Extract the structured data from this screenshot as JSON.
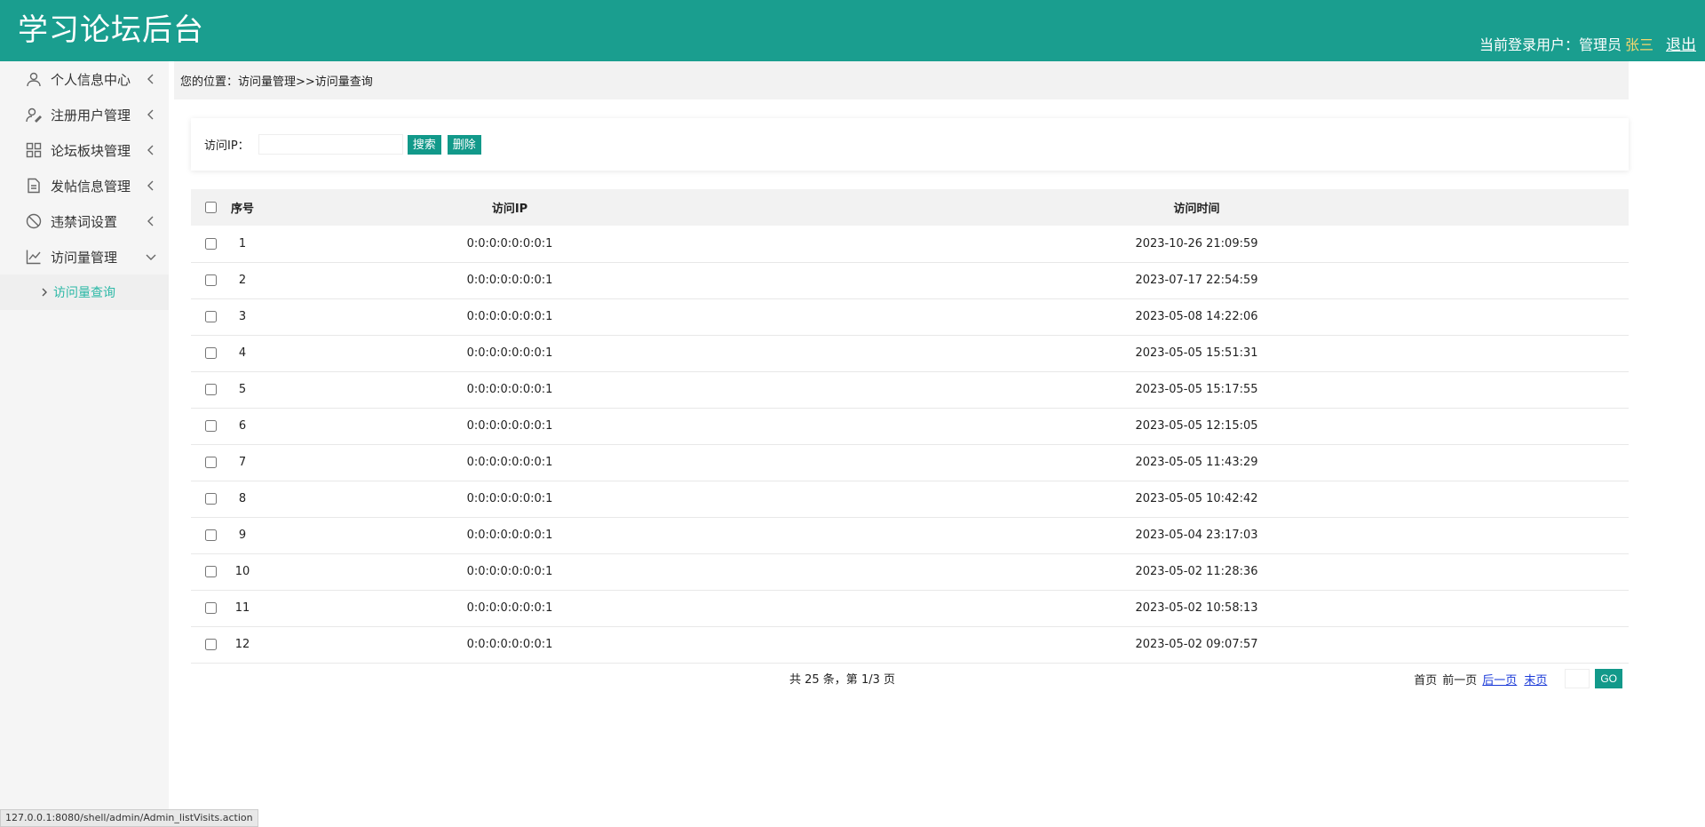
{
  "header": {
    "title": "学习论坛后台",
    "user_prefix": "当前登录用户：管理员",
    "user_name": "张三",
    "logout": "退出"
  },
  "sidebar": {
    "items": [
      {
        "label": "个人信息中心",
        "icon": "user-icon",
        "expanded": false
      },
      {
        "label": "注册用户管理",
        "icon": "user-edit-icon",
        "expanded": false
      },
      {
        "label": "论坛板块管理",
        "icon": "grid-icon",
        "expanded": false
      },
      {
        "label": "发帖信息管理",
        "icon": "document-icon",
        "expanded": false
      },
      {
        "label": "违禁词设置",
        "icon": "ban-icon",
        "expanded": false
      },
      {
        "label": "访问量管理",
        "icon": "chart-line-icon",
        "expanded": true
      }
    ],
    "sub_items": [
      {
        "label": "访问量查询"
      }
    ]
  },
  "breadcrumb": "您的位置：访问量管理>>访问量查询",
  "search": {
    "label": "访问IP：",
    "value": "",
    "search_button": "搜索",
    "delete_button": "删除"
  },
  "table": {
    "headers": [
      "序号",
      "访问IP",
      "访问时间"
    ],
    "rows": [
      {
        "no": "1",
        "ip": "0:0:0:0:0:0:0:1",
        "time": "2023-10-26 21:09:59"
      },
      {
        "no": "2",
        "ip": "0:0:0:0:0:0:0:1",
        "time": "2023-07-17 22:54:59"
      },
      {
        "no": "3",
        "ip": "0:0:0:0:0:0:0:1",
        "time": "2023-05-08 14:22:06"
      },
      {
        "no": "4",
        "ip": "0:0:0:0:0:0:0:1",
        "time": "2023-05-05 15:51:31"
      },
      {
        "no": "5",
        "ip": "0:0:0:0:0:0:0:1",
        "time": "2023-05-05 15:17:55"
      },
      {
        "no": "6",
        "ip": "0:0:0:0:0:0:0:1",
        "time": "2023-05-05 12:15:05"
      },
      {
        "no": "7",
        "ip": "0:0:0:0:0:0:0:1",
        "time": "2023-05-05 11:43:29"
      },
      {
        "no": "8",
        "ip": "0:0:0:0:0:0:0:1",
        "time": "2023-05-05 10:42:42"
      },
      {
        "no": "9",
        "ip": "0:0:0:0:0:0:0:1",
        "time": "2023-05-04 23:17:03"
      },
      {
        "no": "10",
        "ip": "0:0:0:0:0:0:0:1",
        "time": "2023-05-02 11:28:36"
      },
      {
        "no": "11",
        "ip": "0:0:0:0:0:0:0:1",
        "time": "2023-05-02 10:58:13"
      },
      {
        "no": "12",
        "ip": "0:0:0:0:0:0:0:1",
        "time": "2023-05-02 09:07:57"
      }
    ]
  },
  "pager": {
    "summary": "共 25 条，第 1/3 页",
    "first": "首页",
    "prev": "前一页",
    "next": "后一页",
    "last": "末页",
    "page_input": "",
    "go": "GO"
  },
  "statusbar": "127.0.0.1:8080/shell/admin/Admin_listVisits.action",
  "colors": {
    "primary": "#1a9e8f",
    "button": "#12998a",
    "user_name": "#f5d76e",
    "active_sub": "#2bb8a6",
    "link": "#1a3ad8"
  }
}
